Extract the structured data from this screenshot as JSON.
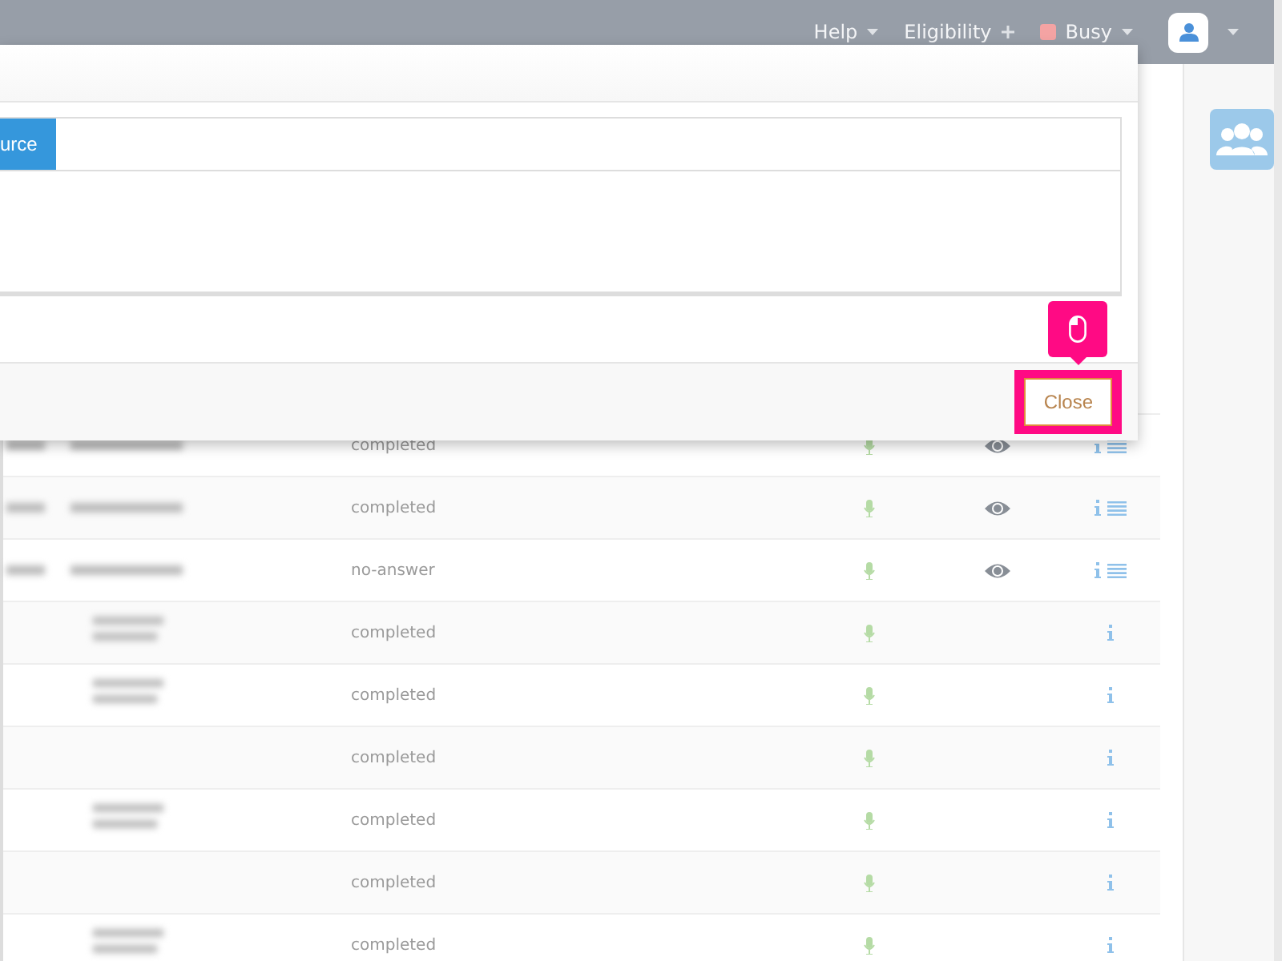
{
  "topbar": {
    "menus": [
      {
        "label": "Help",
        "kind": "dropdown"
      },
      {
        "label": "Eligibility",
        "kind": "plus"
      }
    ],
    "status": {
      "label": "Busy",
      "color": "#f4a3a3"
    },
    "account": {
      "kind": "dropdown"
    }
  },
  "modal": {
    "tabs": [
      {
        "label": "urce",
        "selected": true
      }
    ],
    "close_button": "Close",
    "tour_highlight": true
  },
  "table": {
    "rows": [
      {
        "status": "completed",
        "kind": "wide",
        "eye": true,
        "list": true
      },
      {
        "status": "completed",
        "kind": "wide",
        "eye": true,
        "list": true
      },
      {
        "status": "no-answer",
        "kind": "wide",
        "eye": true,
        "list": true
      },
      {
        "status": "completed",
        "kind": "stacked",
        "eye": false,
        "list": false
      },
      {
        "status": "completed",
        "kind": "stacked",
        "eye": false,
        "list": false
      },
      {
        "status": "completed",
        "kind": "plain",
        "eye": false,
        "list": false
      },
      {
        "status": "completed",
        "kind": "stacked",
        "eye": false,
        "list": false
      },
      {
        "status": "completed",
        "kind": "plain",
        "eye": false,
        "list": false
      },
      {
        "status": "completed",
        "kind": "stacked",
        "eye": false,
        "list": false
      }
    ]
  }
}
